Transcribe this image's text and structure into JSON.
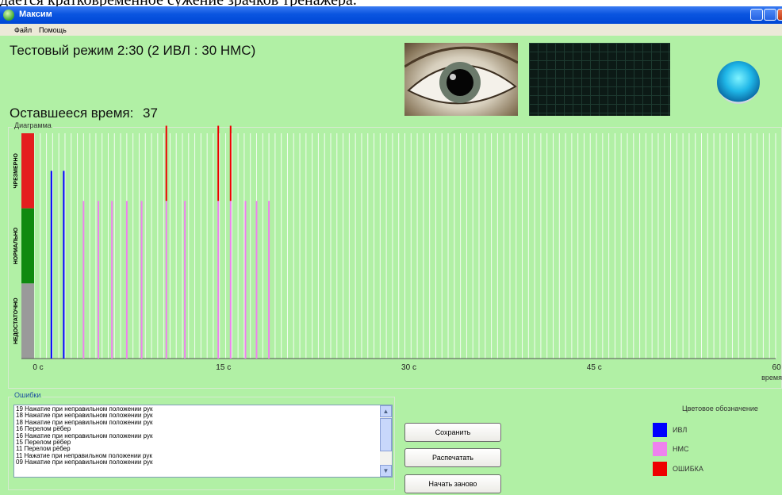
{
  "document": {
    "caption_fragment": "дается кратковременное сужение зрачков тренажера."
  },
  "window": {
    "title": "Максим",
    "controls": [
      "minimize",
      "maximize",
      "close"
    ]
  },
  "menu": {
    "items": [
      "Файл",
      "Помощь"
    ]
  },
  "header": {
    "mode_text": "Тестовый режим 2:30 (2 ИВЛ : 30 НМС)",
    "remaining_label": "Оставшееся время:",
    "remaining_value": "37"
  },
  "diagram": {
    "group_label": "Диаграмма",
    "zones": [
      "ЧРЕЗМЕРНО",
      "НОРМАЛЬНО",
      "НЕДОСТАТОЧНО"
    ],
    "zone_colors": [
      "#e41e1e",
      "#0f8a0f",
      "#9a9a9a"
    ],
    "x_ticks": [
      "0 c",
      "15 c",
      "30 c",
      "45 c",
      "60 c"
    ],
    "x_axis_label": "время",
    "event_colors": {
      "ivl": "#0000ff",
      "nms": "#ee82ee",
      "error": "#ee0000"
    }
  },
  "chart_data": {
    "type": "bar",
    "x_axis": {
      "label": "время",
      "range": [
        0,
        60
      ],
      "ticks": [
        0,
        15,
        30,
        45,
        60
      ],
      "unit": "c"
    },
    "y_axis": {
      "categories": [
        "НЕДОСТАТОЧНО",
        "НОРМАЛЬНО",
        "ЧРЕЗМЕРНО"
      ],
      "range": [
        0,
        3
      ]
    },
    "series": [
      {
        "name": "ИВЛ",
        "color": "#0000ff",
        "points": [
          {
            "t": 1.4,
            "level": 2.5
          },
          {
            "t": 2.4,
            "level": 2.5
          }
        ]
      },
      {
        "name": "НМС",
        "color": "#ee82ee",
        "points": [
          {
            "t": 4.0,
            "level": 2.1
          },
          {
            "t": 5.2,
            "level": 2.1
          },
          {
            "t": 6.3,
            "level": 2.1
          },
          {
            "t": 7.5,
            "level": 2.1
          },
          {
            "t": 8.7,
            "level": 2.1
          },
          {
            "t": 10.7,
            "level": 2.1
          },
          {
            "t": 12.2,
            "level": 2.1
          },
          {
            "t": 14.9,
            "level": 2.1
          },
          {
            "t": 15.9,
            "level": 2.1
          },
          {
            "t": 17.1,
            "level": 2.1
          },
          {
            "t": 18.0,
            "level": 2.1
          },
          {
            "t": 19.0,
            "level": 2.1
          }
        ]
      },
      {
        "name": "ОШИБКА",
        "color": "#ee0000",
        "points": [
          {
            "t": 10.7,
            "from": 2.1,
            "to": 3.1
          },
          {
            "t": 14.9,
            "from": 2.1,
            "to": 3.1
          },
          {
            "t": 15.9,
            "from": 2.1,
            "to": 3.1
          }
        ]
      }
    ],
    "grid": true
  },
  "errors": {
    "group_label": "Ошибки",
    "items": [
      "19 Нажатие при неправильном положении рук",
      "18 Нажатие при неправильном положении рук",
      "18 Нажатие при неправильном положении рук",
      "16 Перелом рёбер",
      "16 Нажатие при неправильном положении рук",
      "15 Перелом рёбер",
      "11 Перелом рёбер",
      "11 Нажатие при неправильном положении рук",
      "09 Нажатие при неправильном положении рук"
    ]
  },
  "buttons": {
    "save": "Сохранить",
    "print": "Распечатать",
    "restart": "Начать заново"
  },
  "legend": {
    "title": "Цветовое обозначение",
    "items": [
      {
        "label": "ИВЛ",
        "color": "#0000ff"
      },
      {
        "label": "НМС",
        "color": "#ee82ee"
      },
      {
        "label": "ОШИБКА",
        "color": "#ee0000"
      }
    ]
  }
}
